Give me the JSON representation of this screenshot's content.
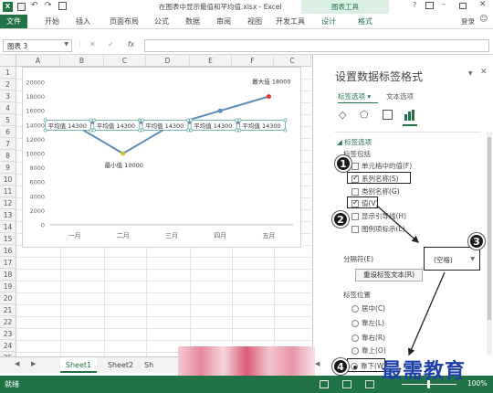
{
  "window": {
    "title": "在图表中显示最值和平均值.xlsx - Excel",
    "tools_label": "图表工具",
    "user": "登录"
  },
  "ribbon": {
    "tabs": [
      "文件",
      "开始",
      "插入",
      "页面布局",
      "公式",
      "数据",
      "审阅",
      "视图",
      "开发工具",
      "设计",
      "格式"
    ]
  },
  "formula_bar": {
    "name_box": "图表 3",
    "fx": "fx"
  },
  "grid": {
    "columns": [
      "A",
      "B",
      "C",
      "D",
      "E",
      "F",
      "C"
    ],
    "rows": [
      "1",
      "2",
      "3",
      "4",
      "5",
      "6",
      "7",
      "8",
      "9",
      "10",
      "11",
      "12",
      "13",
      "14",
      "15",
      "16",
      "17",
      "18",
      "19",
      "20",
      "21",
      "22",
      "23",
      "24",
      "25"
    ]
  },
  "chart_data": {
    "type": "line",
    "categories": [
      "一月",
      "二月",
      "三月",
      "四月",
      "五月"
    ],
    "series": [
      {
        "values": [
          14000,
          10000,
          14000,
          16000,
          18000
        ],
        "color": "#5b8db8"
      },
      {
        "values": [
          14300,
          14300,
          14300,
          14300,
          14300
        ],
        "color": "#7b5fa8"
      }
    ],
    "ylim": [
      0,
      20000
    ],
    "yticks": [
      "20000",
      "18000",
      "16000",
      "14000",
      "12000",
      "10000",
      "8000",
      "6000",
      "4000",
      "2000",
      "0"
    ],
    "avg_labels": [
      "平均值 14300",
      "平均值 14300",
      "平均值 14300",
      "平均值 14300",
      "平均值 14300"
    ],
    "max_label": "最大值 18000",
    "min_label": "最小值 10000"
  },
  "pane": {
    "title": "设置数据标签格式",
    "tab_options": "标签选项",
    "tab_text": "文本选项",
    "section": "标签选项",
    "contains": "标签包括",
    "opt_cell": "单元格中的值(F)",
    "opt_series": "系列名称(S)",
    "opt_category": "类别名称(G)",
    "opt_value": "值(V)",
    "opt_leader": "显示引导线(H)",
    "opt_legend": "图例项标示(L)",
    "separator_label": "分隔符(E)",
    "separator_value": "(空格)",
    "reset_button": "重设标签文本(R)",
    "position_label": "标签位置",
    "pos_center": "居中(C)",
    "pos_left": "靠左(L)",
    "pos_right": "靠右(R)",
    "pos_above": "靠上(O)",
    "pos_below": "靠下(W)"
  },
  "sheets": {
    "tabs": [
      "Sheet1",
      "Sheet2",
      "Sh"
    ]
  },
  "status": {
    "ready": "就绪",
    "zoom": "100%"
  },
  "badges": [
    "1",
    "2",
    "3",
    "4"
  ],
  "watermark": "最需教育"
}
